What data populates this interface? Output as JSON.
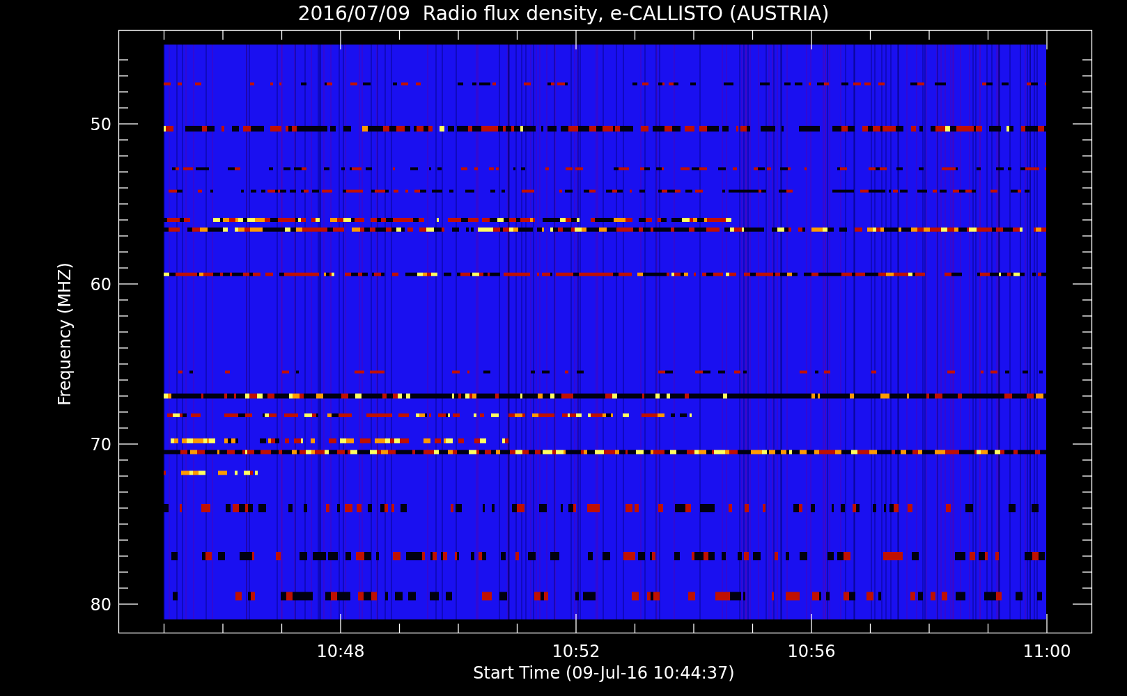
{
  "plot": {
    "title": "2016/07/09  Radio flux density, e-CALLISTO (AUSTRIA)",
    "x_axis": {
      "label": "Start Time (09-Jul-16 10:44:37)",
      "tick_labels": [
        "10:48",
        "10:52",
        "10:56",
        "11:00"
      ]
    },
    "y_axis": {
      "label": "Frequency (MHZ)",
      "tick_labels": [
        "50",
        "60",
        "70",
        "80"
      ]
    }
  }
}
